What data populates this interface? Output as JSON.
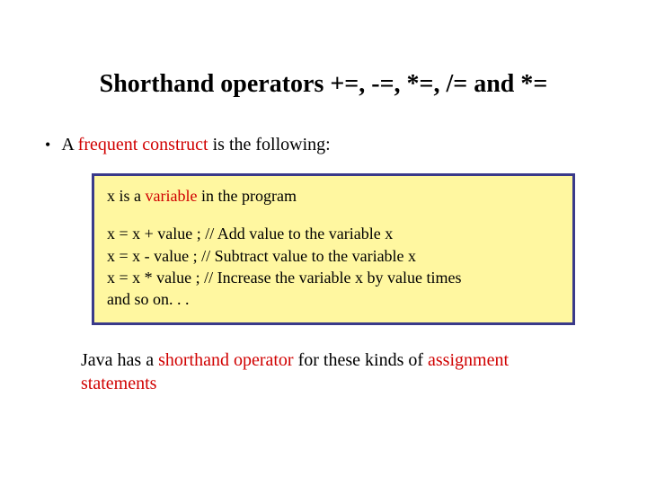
{
  "title": "Shorthand operators +=, -=, *=, /= and *=",
  "bullet": {
    "prefix": "A ",
    "highlight": "frequent construct",
    "suffix": " is the following:"
  },
  "codebox": {
    "line1_a": "x is a ",
    "line1_b": "variable",
    "line1_c": " in the program",
    "line2": "x = x + value ;   // Add value to the variable x",
    "line3": "x = x - value ;   // Subtract value to the variable x",
    "line4": "x = x * value ;   // Increase the variable x by value times",
    "line5": "and so on. . ."
  },
  "footer": {
    "a": "Java has a ",
    "b": "shorthand operator",
    "c": " for these kinds of ",
    "d": "assignment statements"
  }
}
